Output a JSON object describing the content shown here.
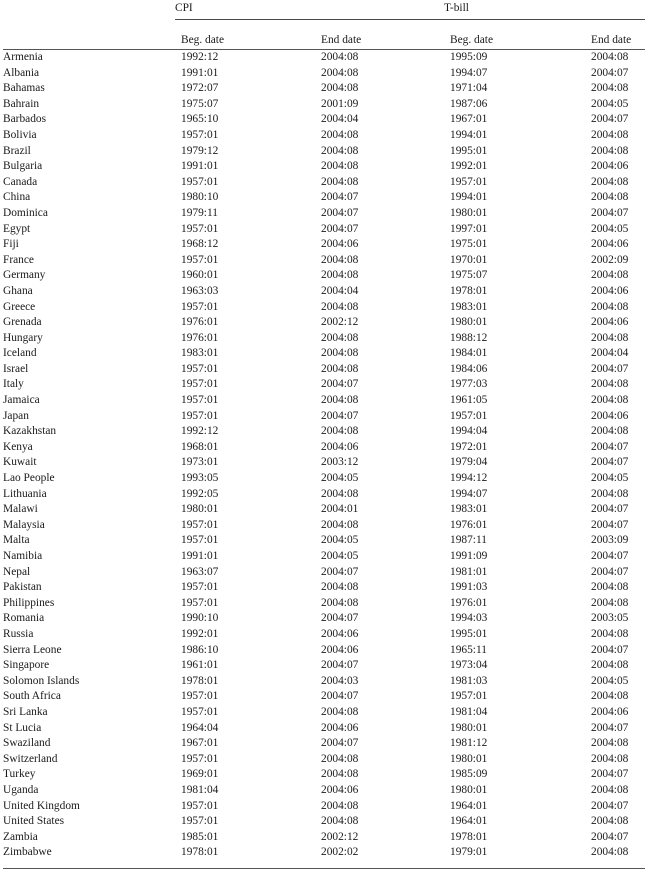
{
  "table": {
    "column_groups": [
      {
        "label": "",
        "name": "country-group"
      },
      {
        "label": "CPI",
        "name": "cpi-group"
      },
      {
        "label": "T-bill",
        "name": "tbill-group"
      }
    ],
    "headers": {
      "country": "",
      "cpi_beg": "Beg. date",
      "cpi_end": "End date",
      "tbill_beg": "Beg. date",
      "tbill_end": "End date"
    },
    "rows": [
      {
        "country": "Armenia",
        "cpi_beg": "1992:12",
        "cpi_end": "2004:08",
        "tbill_beg": "1995:09",
        "tbill_end": "2004:08"
      },
      {
        "country": "Albania",
        "cpi_beg": "1991:01",
        "cpi_end": "2004:08",
        "tbill_beg": "1994:07",
        "tbill_end": "2004:07"
      },
      {
        "country": "Bahamas",
        "cpi_beg": "1972:07",
        "cpi_end": "2004:08",
        "tbill_beg": "1971:04",
        "tbill_end": "2004:08"
      },
      {
        "country": "Bahrain",
        "cpi_beg": "1975:07",
        "cpi_end": "2001:09",
        "tbill_beg": "1987:06",
        "tbill_end": "2004:05"
      },
      {
        "country": "Barbados",
        "cpi_beg": "1965:10",
        "cpi_end": "2004:04",
        "tbill_beg": "1967:01",
        "tbill_end": "2004:07"
      },
      {
        "country": "Bolivia",
        "cpi_beg": "1957:01",
        "cpi_end": "2004:08",
        "tbill_beg": "1994:01",
        "tbill_end": "2004:08"
      },
      {
        "country": "Brazil",
        "cpi_beg": "1979:12",
        "cpi_end": "2004:08",
        "tbill_beg": "1995:01",
        "tbill_end": "2004:08"
      },
      {
        "country": "Bulgaria",
        "cpi_beg": "1991:01",
        "cpi_end": "2004:08",
        "tbill_beg": "1992:01",
        "tbill_end": "2004:06"
      },
      {
        "country": "Canada",
        "cpi_beg": "1957:01",
        "cpi_end": "2004:08",
        "tbill_beg": "1957:01",
        "tbill_end": "2004:08"
      },
      {
        "country": "China",
        "cpi_beg": "1980:10",
        "cpi_end": "2004:07",
        "tbill_beg": "1994:01",
        "tbill_end": "2004:08"
      },
      {
        "country": "Dominica",
        "cpi_beg": "1979:11",
        "cpi_end": "2004:07",
        "tbill_beg": "1980:01",
        "tbill_end": "2004:07"
      },
      {
        "country": "Egypt",
        "cpi_beg": "1957:01",
        "cpi_end": "2004:07",
        "tbill_beg": "1997:01",
        "tbill_end": "2004:05"
      },
      {
        "country": "Fiji",
        "cpi_beg": "1968:12",
        "cpi_end": "2004:06",
        "tbill_beg": "1975:01",
        "tbill_end": "2004:06"
      },
      {
        "country": "France",
        "cpi_beg": "1957:01",
        "cpi_end": "2004:08",
        "tbill_beg": "1970:01",
        "tbill_end": "2002:09"
      },
      {
        "country": "Germany",
        "cpi_beg": "1960:01",
        "cpi_end": "2004:08",
        "tbill_beg": "1975:07",
        "tbill_end": "2004:08"
      },
      {
        "country": "Ghana",
        "cpi_beg": "1963:03",
        "cpi_end": "2004:04",
        "tbill_beg": "1978:01",
        "tbill_end": "2004:06"
      },
      {
        "country": "Greece",
        "cpi_beg": "1957:01",
        "cpi_end": "2004:08",
        "tbill_beg": "1983:01",
        "tbill_end": "2004:08"
      },
      {
        "country": "Grenada",
        "cpi_beg": "1976:01",
        "cpi_end": "2002:12",
        "tbill_beg": "1980:01",
        "tbill_end": "2004:06"
      },
      {
        "country": "Hungary",
        "cpi_beg": "1976:01",
        "cpi_end": "2004:08",
        "tbill_beg": "1988:12",
        "tbill_end": "2004:08"
      },
      {
        "country": "Iceland",
        "cpi_beg": "1983:01",
        "cpi_end": "2004:08",
        "tbill_beg": "1984:01",
        "tbill_end": "2004:04"
      },
      {
        "country": "Israel",
        "cpi_beg": "1957:01",
        "cpi_end": "2004:08",
        "tbill_beg": "1984:06",
        "tbill_end": "2004:07"
      },
      {
        "country": "Italy",
        "cpi_beg": "1957:01",
        "cpi_end": "2004:07",
        "tbill_beg": "1977:03",
        "tbill_end": "2004:08"
      },
      {
        "country": "Jamaica",
        "cpi_beg": "1957:01",
        "cpi_end": "2004:08",
        "tbill_beg": "1961:05",
        "tbill_end": "2004:08"
      },
      {
        "country": "Japan",
        "cpi_beg": "1957:01",
        "cpi_end": "2004:07",
        "tbill_beg": "1957:01",
        "tbill_end": "2004:06"
      },
      {
        "country": "Kazakhstan",
        "cpi_beg": "1992:12",
        "cpi_end": "2004:08",
        "tbill_beg": "1994:04",
        "tbill_end": "2004:08"
      },
      {
        "country": "Kenya",
        "cpi_beg": "1968:01",
        "cpi_end": "2004:06",
        "tbill_beg": "1972:01",
        "tbill_end": "2004:07"
      },
      {
        "country": "Kuwait",
        "cpi_beg": "1973:01",
        "cpi_end": "2003:12",
        "tbill_beg": "1979:04",
        "tbill_end": "2004:07"
      },
      {
        "country": "Lao People",
        "cpi_beg": "1993:05",
        "cpi_end": "2004:05",
        "tbill_beg": "1994:12",
        "tbill_end": "2004:05"
      },
      {
        "country": "Lithuania",
        "cpi_beg": "1992:05",
        "cpi_end": "2004:08",
        "tbill_beg": "1994:07",
        "tbill_end": "2004:08"
      },
      {
        "country": "Malawi",
        "cpi_beg": "1980:01",
        "cpi_end": "2004:01",
        "tbill_beg": "1983:01",
        "tbill_end": "2004:07"
      },
      {
        "country": "Malaysia",
        "cpi_beg": "1957:01",
        "cpi_end": "2004:08",
        "tbill_beg": "1976:01",
        "tbill_end": "2004:07"
      },
      {
        "country": "Malta",
        "cpi_beg": "1957:01",
        "cpi_end": "2004:05",
        "tbill_beg": "1987:11",
        "tbill_end": "2003:09"
      },
      {
        "country": "Namibia",
        "cpi_beg": "1991:01",
        "cpi_end": "2004:05",
        "tbill_beg": "1991:09",
        "tbill_end": "2004:07"
      },
      {
        "country": "Nepal",
        "cpi_beg": "1963:07",
        "cpi_end": "2004:07",
        "tbill_beg": "1981:01",
        "tbill_end": "2004:07"
      },
      {
        "country": "Pakistan",
        "cpi_beg": "1957:01",
        "cpi_end": "2004:08",
        "tbill_beg": "1991:03",
        "tbill_end": "2004:08"
      },
      {
        "country": "Philippines",
        "cpi_beg": "1957:01",
        "cpi_end": "2004:08",
        "tbill_beg": "1976:01",
        "tbill_end": "2004:08"
      },
      {
        "country": "Romania",
        "cpi_beg": "1990:10",
        "cpi_end": "2004:07",
        "tbill_beg": "1994:03",
        "tbill_end": "2003:05"
      },
      {
        "country": "Russia",
        "cpi_beg": "1992:01",
        "cpi_end": "2004:06",
        "tbill_beg": "1995:01",
        "tbill_end": "2004:08"
      },
      {
        "country": "Sierra Leone",
        "cpi_beg": "1986:10",
        "cpi_end": "2004:06",
        "tbill_beg": "1965:11",
        "tbill_end": "2004:07"
      },
      {
        "country": "Singapore",
        "cpi_beg": "1961:01",
        "cpi_end": "2004:07",
        "tbill_beg": "1973:04",
        "tbill_end": "2004:08"
      },
      {
        "country": "Solomon Islands",
        "cpi_beg": "1978:01",
        "cpi_end": "2004:03",
        "tbill_beg": "1981:03",
        "tbill_end": "2004:05"
      },
      {
        "country": "South Africa",
        "cpi_beg": "1957:01",
        "cpi_end": "2004:07",
        "tbill_beg": "1957:01",
        "tbill_end": "2004:08"
      },
      {
        "country": "Sri Lanka",
        "cpi_beg": "1957:01",
        "cpi_end": "2004:08",
        "tbill_beg": "1981:04",
        "tbill_end": "2004:06"
      },
      {
        "country": "St Lucia",
        "cpi_beg": "1964:04",
        "cpi_end": "2004:06",
        "tbill_beg": "1980:01",
        "tbill_end": "2004:07"
      },
      {
        "country": "Swaziland",
        "cpi_beg": "1967:01",
        "cpi_end": "2004:07",
        "tbill_beg": "1981:12",
        "tbill_end": "2004:08"
      },
      {
        "country": "Switzerland",
        "cpi_beg": "1957:01",
        "cpi_end": "2004:08",
        "tbill_beg": "1980:01",
        "tbill_end": "2004:08"
      },
      {
        "country": "Turkey",
        "cpi_beg": "1969:01",
        "cpi_end": "2004:08",
        "tbill_beg": "1985:09",
        "tbill_end": "2004:07"
      },
      {
        "country": "Uganda",
        "cpi_beg": "1981:04",
        "cpi_end": "2004:06",
        "tbill_beg": "1980:01",
        "tbill_end": "2004:08"
      },
      {
        "country": "United Kingdom",
        "cpi_beg": "1957:01",
        "cpi_end": "2004:08",
        "tbill_beg": "1964:01",
        "tbill_end": "2004:07"
      },
      {
        "country": "United States",
        "cpi_beg": "1957:01",
        "cpi_end": "2004:08",
        "tbill_beg": "1964:01",
        "tbill_end": "2004:08"
      },
      {
        "country": "Zambia",
        "cpi_beg": "1985:01",
        "cpi_end": "2002:12",
        "tbill_beg": "1978:01",
        "tbill_end": "2004:07"
      },
      {
        "country": "Zimbabwe",
        "cpi_beg": "1978:01",
        "cpi_end": "2002:02",
        "tbill_beg": "1979:01",
        "tbill_end": "2004:08"
      }
    ]
  }
}
